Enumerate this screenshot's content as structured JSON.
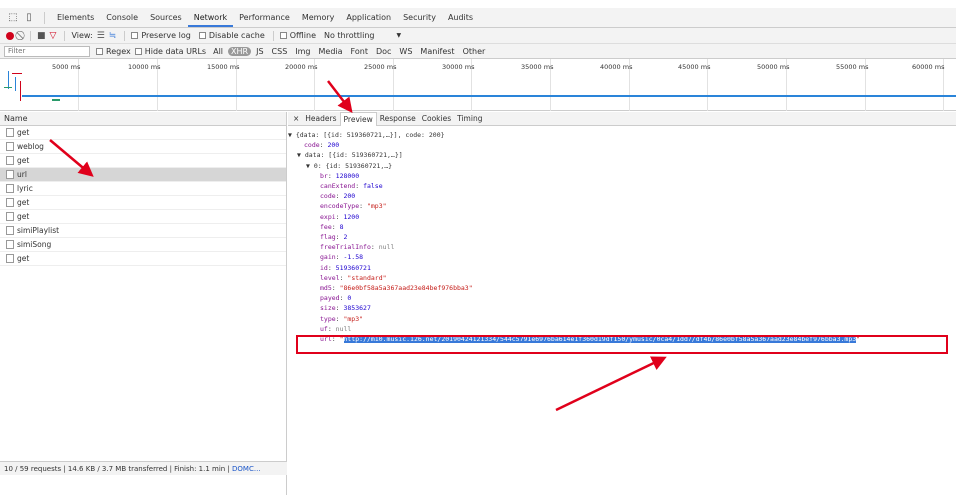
{
  "devtools_tabs": [
    "Elements",
    "Console",
    "Sources",
    "Network",
    "Performance",
    "Memory",
    "Application",
    "Security",
    "Audits"
  ],
  "toolbar": {
    "view_label": "View:",
    "preserve_log": "Preserve log",
    "disable_cache": "Disable cache",
    "offline": "Offline",
    "throttling": "No throttling",
    "throttle_arrow": "▼"
  },
  "filterbar": {
    "placeholder": "Filter",
    "regex": "Regex",
    "hide_data_urls": "Hide data URLs",
    "types": [
      "All",
      "XHR",
      "JS",
      "CSS",
      "Img",
      "Media",
      "Font",
      "Doc",
      "WS",
      "Manifest",
      "Other"
    ]
  },
  "timeline": {
    "ticks": [
      "5000 ms",
      "10000 ms",
      "15000 ms",
      "20000 ms",
      "25000 ms",
      "30000 ms",
      "35000 ms",
      "40000 ms",
      "45000 ms",
      "50000 ms",
      "55000 ms",
      "60000 ms"
    ]
  },
  "request_list": {
    "header": "Name",
    "items": [
      "get",
      "weblog",
      "get",
      "url",
      "lyric",
      "get",
      "get",
      "simiPlaylist",
      "simiSong",
      "get"
    ],
    "selected_index": 3
  },
  "status_bar": {
    "summary": "10 / 59 requests  |  14.6 KB / 3.7 MB transferred  |  Finish: 1.1 min  |  ",
    "domc": "DOMC..."
  },
  "detail_tabs": [
    "×",
    "Headers",
    "Preview",
    "Response",
    "Cookies",
    "Timing"
  ],
  "preview": {
    "root": "▼ {data: [{id: 519360721,…}], code: 200}",
    "code_key": "code",
    "code_val": "200",
    "data_line": "▼ data: [{id: 519360721,…}]",
    "item_line": "▼ 0: {id: 519360721,…}",
    "fields": [
      {
        "k": "br",
        "v": "128000",
        "t": "n"
      },
      {
        "k": "canExtend",
        "v": "false",
        "t": "n"
      },
      {
        "k": "code",
        "v": "200",
        "t": "n"
      },
      {
        "k": "encodeType",
        "v": "\"mp3\"",
        "t": "s"
      },
      {
        "k": "expi",
        "v": "1200",
        "t": "n"
      },
      {
        "k": "fee",
        "v": "8",
        "t": "n"
      },
      {
        "k": "flag",
        "v": "2",
        "t": "n"
      },
      {
        "k": "freeTrialInfo",
        "v": "null",
        "t": "nul"
      },
      {
        "k": "gain",
        "v": "-1.58",
        "t": "n"
      },
      {
        "k": "id",
        "v": "519360721",
        "t": "n"
      },
      {
        "k": "level",
        "v": "\"standard\"",
        "t": "s"
      },
      {
        "k": "md5",
        "v": "\"86e0bf58a5a367aad23e84bef976bba3\"",
        "t": "s"
      },
      {
        "k": "payed",
        "v": "0",
        "t": "n"
      },
      {
        "k": "size",
        "v": "3853627",
        "t": "n"
      },
      {
        "k": "type",
        "v": "\"mp3\"",
        "t": "s"
      },
      {
        "k": "uf",
        "v": "null",
        "t": "nul"
      }
    ],
    "url_key": "url",
    "url_quote_open": "\"",
    "url_val": "http://m10.music.126.net/20190424121334/544c5791e6976ba614e1f360d19df150/ymusic/0ca4/1dd7/df4b/86e0bf58a5a367aad23e84bef976bba3.mp3",
    "url_quote_close": "\""
  }
}
